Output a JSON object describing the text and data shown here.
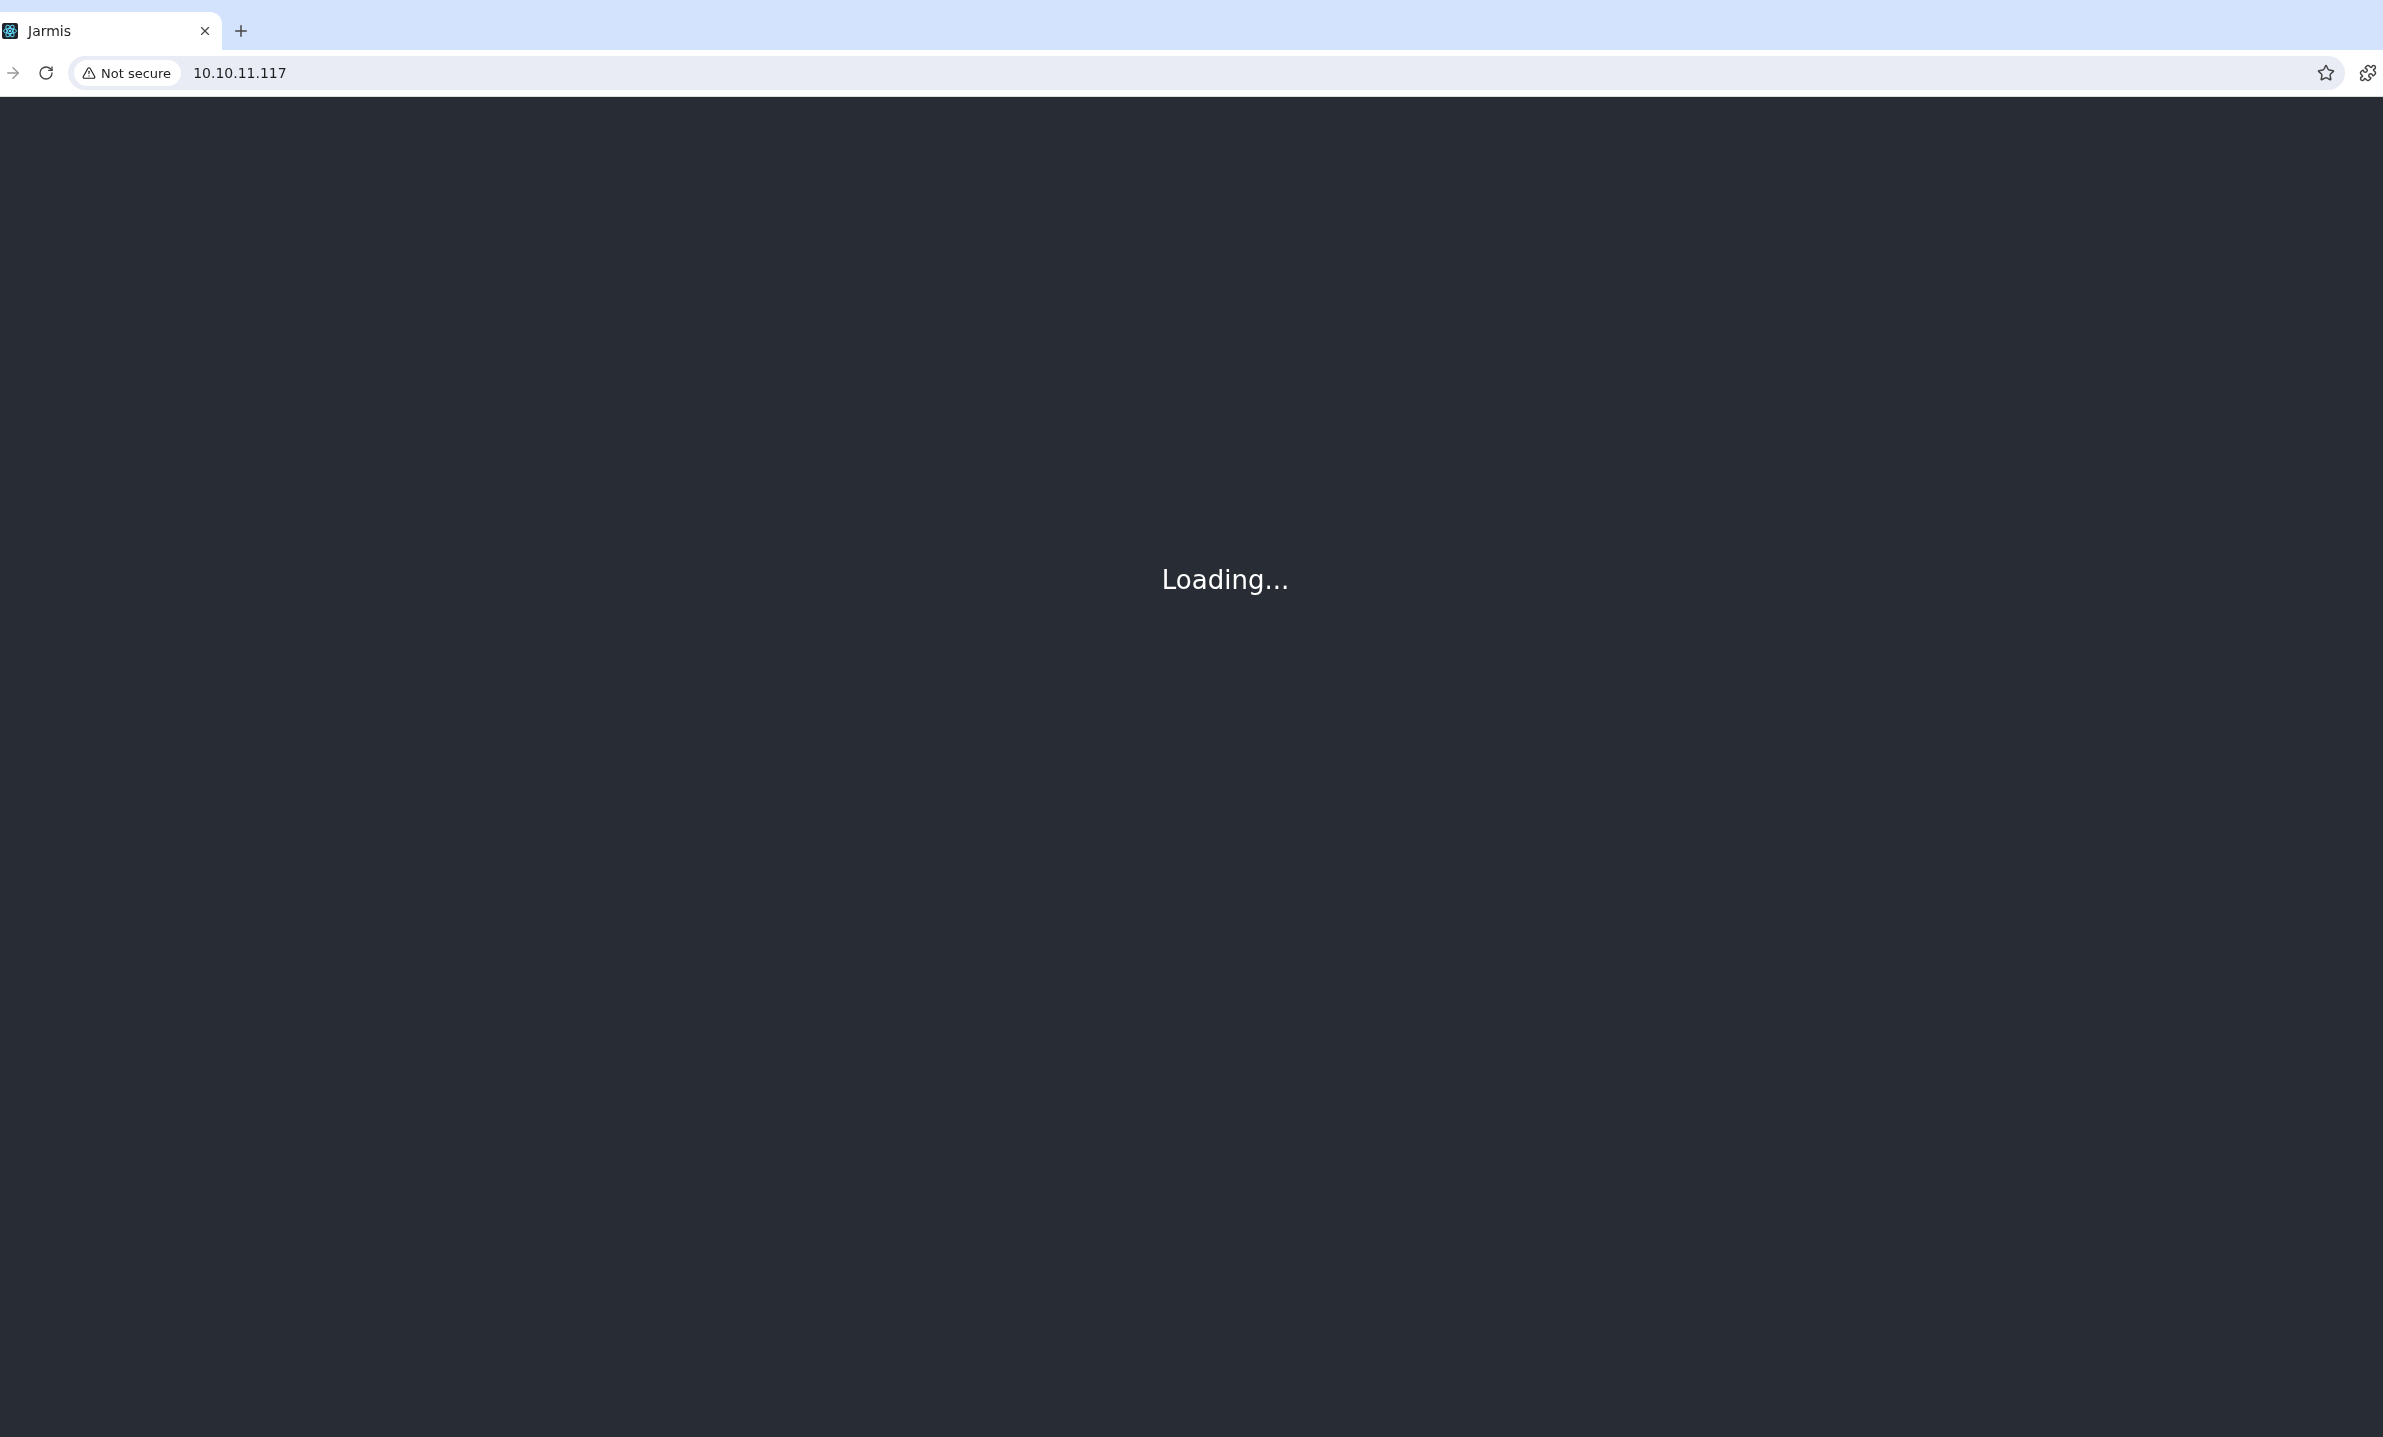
{
  "tabs": [
    {
      "title": "Jarmis",
      "selected": true
    }
  ],
  "toolbar": {
    "security_label": "Not secure",
    "url": "10.10.11.117"
  },
  "page": {
    "message": "Loading..."
  }
}
